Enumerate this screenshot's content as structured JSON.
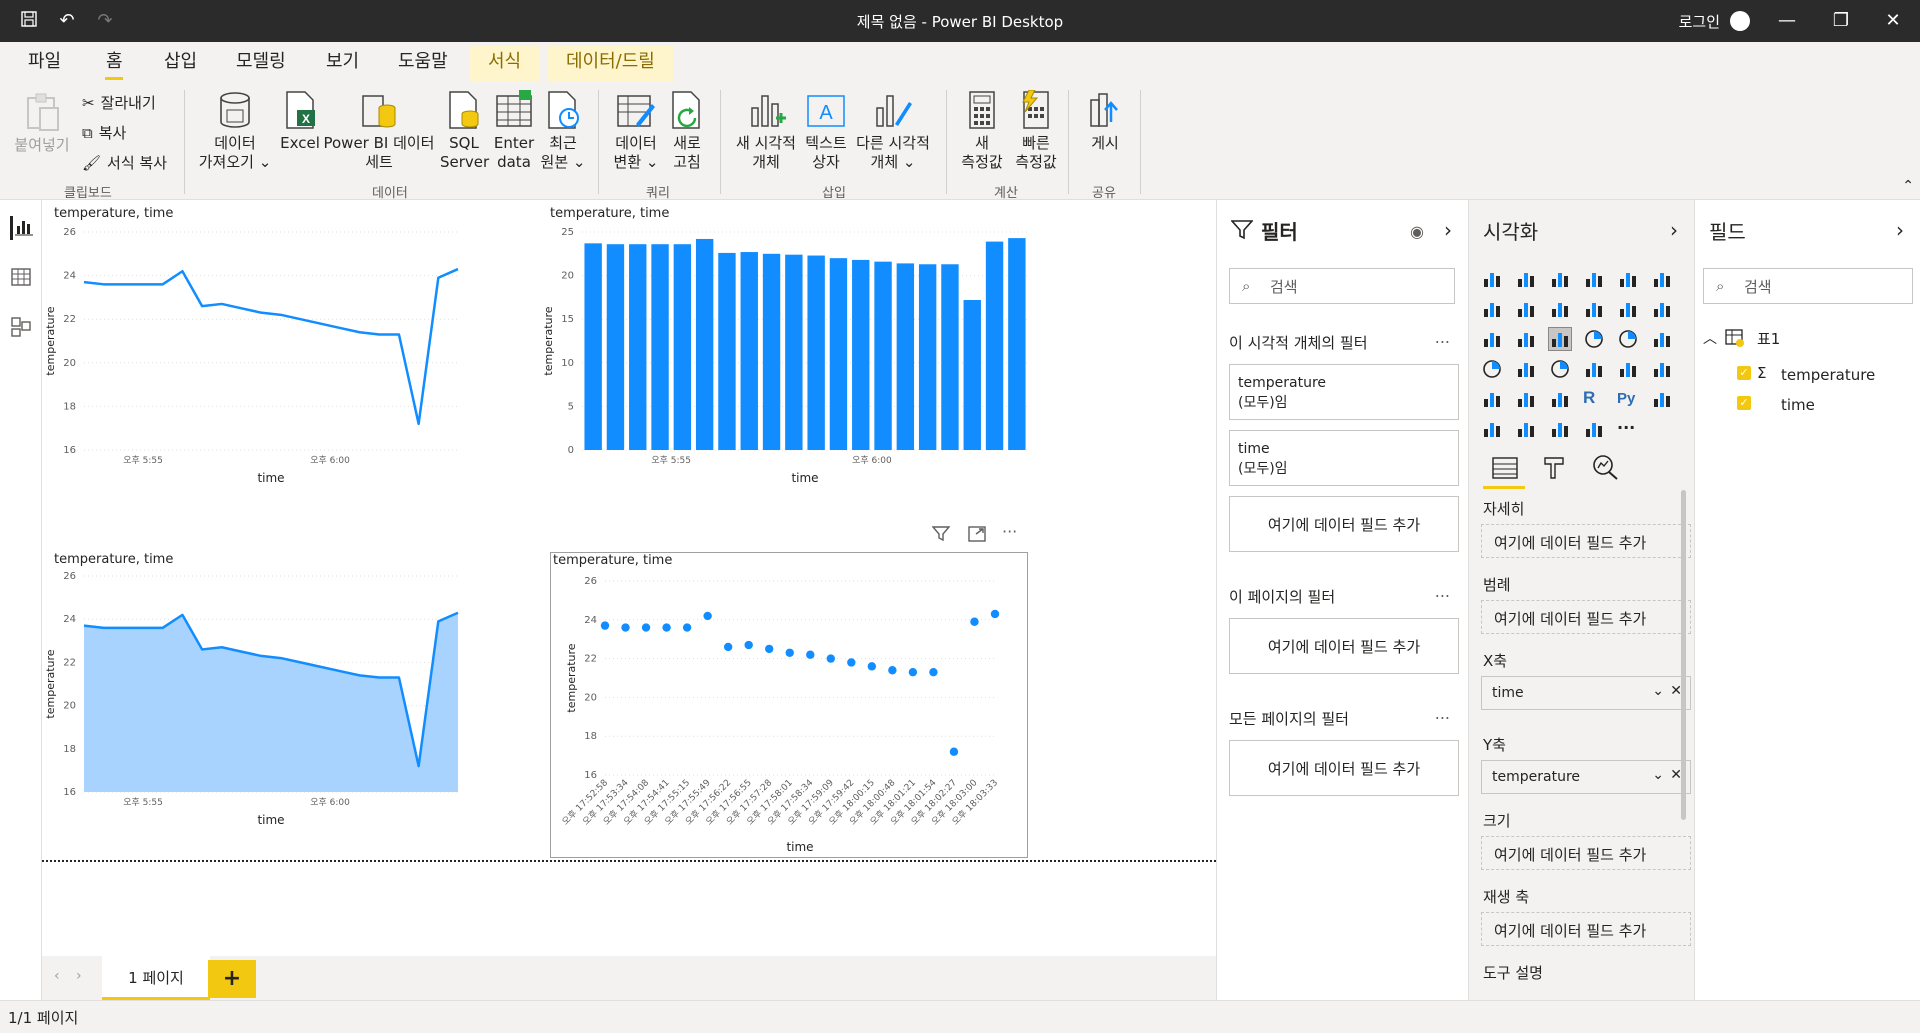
{
  "window": {
    "title": "제목 없음 - Power BI Desktop",
    "login": "로그인"
  },
  "tabs": [
    "파일",
    "홈",
    "삽입",
    "모델링",
    "보기",
    "도움말",
    "서식",
    "데이터/드릴"
  ],
  "ribbon": {
    "clipboard": {
      "paste": "붙여넣기",
      "cut": "잘라내기",
      "copy": "복사",
      "format_copy": "서식 복사",
      "label": "클립보드"
    },
    "data": {
      "get_data_1": "데이터",
      "get_data_2": "가져오기",
      "excel": "Excel",
      "pbi_dataset_1": "Power BI 데이터",
      "pbi_dataset_2": "세트",
      "sql_1": "SQL",
      "sql_2": "Server",
      "enter_1": "Enter",
      "enter_2": "data",
      "recent_1": "최근",
      "recent_2": "원본",
      "label": "데이터"
    },
    "query": {
      "transform_1": "데이터",
      "transform_2": "변환",
      "refresh_1": "새로",
      "refresh_2": "고침",
      "label": "쿼리"
    },
    "insert": {
      "new_visual_1": "새 시각적",
      "new_visual_2": "개체",
      "textbox_1": "텍스트",
      "textbox_2": "상자",
      "more_visuals_1": "다른 시각적",
      "more_visuals_2": "개체",
      "label": "삽입"
    },
    "calc": {
      "new_measure_1": "새",
      "new_measure_2": "측정값",
      "quick_measure_1": "빠른",
      "quick_measure_2": "측정값",
      "label": "계산"
    },
    "share": {
      "publish": "게시",
      "label": "공유"
    }
  },
  "visual_title": "temperature, time",
  "chart_data": [
    {
      "type": "line",
      "title": "temperature, time",
      "xlabel": "time",
      "ylabel": "temperature",
      "ylim": [
        16,
        26
      ],
      "yticks": [
        16,
        18,
        20,
        22,
        24,
        26
      ],
      "xticks": [
        "오후 5:55",
        "오후 6:00"
      ],
      "values": [
        23.7,
        23.6,
        23.6,
        23.6,
        23.6,
        24.2,
        22.6,
        22.7,
        22.5,
        22.3,
        22.2,
        22.0,
        21.8,
        21.6,
        21.4,
        21.3,
        21.3,
        17.2,
        23.9,
        24.3
      ]
    },
    {
      "type": "bar",
      "title": "temperature, time",
      "xlabel": "time",
      "ylabel": "temperature",
      "ylim": [
        0,
        25
      ],
      "yticks": [
        0,
        5,
        10,
        15,
        20,
        25
      ],
      "xticks": [
        "오후 5:55",
        "오후 6:00"
      ],
      "values": [
        23.7,
        23.6,
        23.6,
        23.6,
        23.6,
        24.2,
        22.6,
        22.7,
        22.5,
        22.4,
        22.3,
        22.0,
        21.8,
        21.6,
        21.4,
        21.3,
        21.3,
        17.2,
        23.9,
        24.3
      ]
    },
    {
      "type": "area",
      "title": "temperature, time",
      "xlabel": "time",
      "ylabel": "temperature",
      "ylim": [
        16,
        26
      ],
      "yticks": [
        16,
        18,
        20,
        22,
        24,
        26
      ],
      "xticks": [
        "오후 5:55",
        "오후 6:00"
      ],
      "values": [
        23.7,
        23.6,
        23.6,
        23.6,
        23.6,
        24.2,
        22.6,
        22.7,
        22.5,
        22.3,
        22.2,
        22.0,
        21.8,
        21.6,
        21.4,
        21.3,
        21.3,
        17.2,
        23.9,
        24.3
      ]
    },
    {
      "type": "scatter",
      "title": "temperature, time",
      "xlabel": "time",
      "ylabel": "temperature",
      "ylim": [
        16,
        26
      ],
      "yticks": [
        16,
        18,
        20,
        22,
        24,
        26
      ],
      "categories": [
        "오후 17:52:58",
        "오후 17:53:34",
        "오후 17:54:08",
        "오후 17:54:41",
        "오후 17:55:15",
        "오후 17:55:49",
        "오후 17:56:22",
        "오후 17:56:55",
        "오후 17:57:28",
        "오후 17:58:01",
        "오후 17:58:34",
        "오후 17:59:09",
        "오후 17:59:42",
        "오후 18:00:15",
        "오후 18:00:48",
        "오후 18:01:21",
        "오후 18:01:54",
        "오후 18:02:27",
        "오후 18:03:00",
        "오후 18:03:33"
      ],
      "values": [
        23.7,
        23.6,
        23.6,
        23.6,
        23.6,
        24.2,
        22.6,
        22.7,
        22.5,
        22.3,
        22.2,
        22.0,
        21.8,
        21.6,
        21.4,
        21.3,
        21.3,
        17.2,
        23.9,
        24.3
      ]
    }
  ],
  "colors": {
    "series": "#118dff",
    "area_fill": "#a8d3ff",
    "accent": "#f2c811"
  },
  "pages": {
    "tab": "1 페이지",
    "add": "+",
    "status": "1/1 페이지"
  },
  "filters": {
    "title": "필터",
    "search": "검색",
    "visual_section": "이 시각적 개체의 필터",
    "card1_field": "temperature",
    "card1_state": "(모두)임",
    "card2_field": "time",
    "card2_state": "(모두)임",
    "add_field": "여기에 데이터 필드 추가",
    "page_section": "이 페이지의 필터",
    "all_section": "모든 페이지의 필터",
    "more": "..."
  },
  "viz": {
    "title": "시각화",
    "wells": {
      "detail": "자세히",
      "legend": "범례",
      "xaxis": "X축",
      "xaxis_value": "time",
      "yaxis": "Y축",
      "yaxis_value": "temperature",
      "size": "크기",
      "play_axis": "재생 축",
      "tooltip": "도구 설명",
      "add_field": "여기에 데이터 필드 추가"
    }
  },
  "fields": {
    "title": "필드",
    "search": "검색",
    "table": "표1",
    "items": [
      "temperature",
      "time"
    ]
  }
}
